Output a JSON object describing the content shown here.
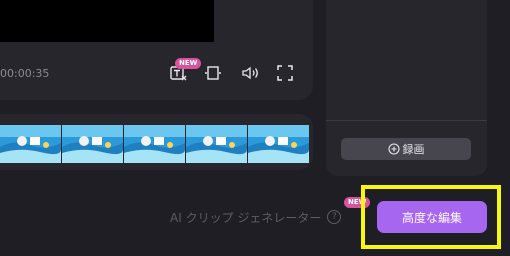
{
  "player": {
    "timecode": "00:00:35",
    "new_badge": "NEW"
  },
  "side_panel": {
    "record_label": "録画"
  },
  "footer": {
    "ai_clip_label": "AI クリップ ジェネレーター",
    "ai_new_badge": "NEW",
    "help_glyph": "?",
    "advanced_edit_label": "高度な編集"
  },
  "colors": {
    "accent": "#a766f0",
    "badge": "#d8529e",
    "highlight": "#f7f70f"
  }
}
